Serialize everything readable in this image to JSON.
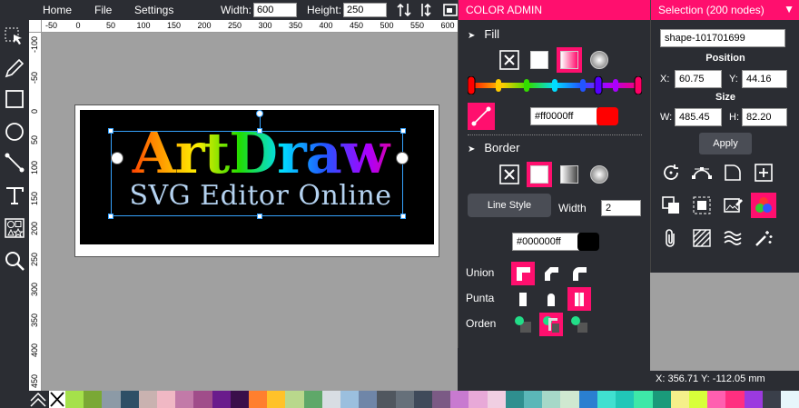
{
  "menu": {
    "home": "Home",
    "file": "File",
    "settings": "Settings"
  },
  "dimensions": {
    "width_label": "Width:",
    "width_value": "600",
    "height_label": "Height:",
    "height_value": "250"
  },
  "ruler": {
    "h": [
      "-50",
      "0",
      "50",
      "100",
      "150",
      "200",
      "250",
      "300",
      "350",
      "400",
      "450",
      "500",
      "550",
      "600"
    ],
    "v": [
      "-100",
      "-50",
      "0",
      "50",
      "100",
      "150",
      "200",
      "250",
      "300",
      "350",
      "400",
      "450"
    ]
  },
  "artwork": {
    "title": "ArtDraw",
    "subtitle": "SVG Editor Online"
  },
  "color_admin": {
    "header": "COLOR ADMIN",
    "fill_title": "Fill",
    "fill_hex": "#ff0000ff",
    "fill_color": "#ff0000",
    "border_title": "Border",
    "line_style": "Line Style",
    "width_label": "Width",
    "width_value": "2",
    "border_hex": "#000000ff",
    "border_color": "#000000",
    "union_label": "Union",
    "punta_label": "Punta",
    "orden_label": "Orden"
  },
  "selection": {
    "header": "Selection (200 nodes)",
    "shape_id": "shape-101701699",
    "position_title": "Position",
    "x_label": "X:",
    "x_value": "60.75",
    "y_label": "Y:",
    "y_value": "44.16",
    "size_title": "Size",
    "w_label": "W:",
    "w_value": "485.45",
    "h_label": "H:",
    "h_value": "82.20",
    "apply": "Apply"
  },
  "status": {
    "coords": "X: 356.71 Y: -112.05 mm"
  },
  "palette": [
    "#a5e14b",
    "#7aa835",
    "#8c9aa6",
    "#2e4f66",
    "#c9b2b0",
    "#f0b8c4",
    "#c27aa8",
    "#a04d8a",
    "#6a1c8c",
    "#3a0f4a",
    "#ff7f2e",
    "#ffc229",
    "#b9d88c",
    "#5fa869",
    "#d8dde3",
    "#9bbfde",
    "#6f86a8",
    "#50575f",
    "#66707a",
    "#3f4a5a",
    "#7b5a85",
    "#c87ad0",
    "#e8a9d8",
    "#f0cfe2",
    "#2f8f8f",
    "#5bb7b8",
    "#a6d8c8",
    "#cfe8d0",
    "#2a7fd0",
    "#40e0d0",
    "#21c7b8",
    "#3ee8a8",
    "#1a9a7a",
    "#f5f08a",
    "#d8ff3a",
    "#ff5fb0",
    "#ff2f80",
    "#9b3adf",
    "#3a3f4a",
    "#e7f6fb"
  ],
  "accent": "#ff0f6e"
}
